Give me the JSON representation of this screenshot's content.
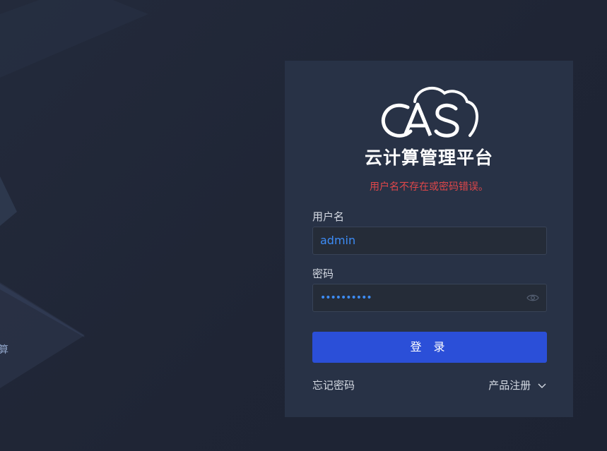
{
  "logo": {
    "text": "CAS"
  },
  "title": "云计算管理平台",
  "error_message": "用户名不存在或密码错误。",
  "form": {
    "username_label": "用户名",
    "username_value": "admin",
    "password_label": "密码",
    "password_mask": "••••••••••"
  },
  "login_button": "登 录",
  "forgot_password": "忘记密码",
  "product_register": "产品注册",
  "background_text": "算",
  "colors": {
    "background": "#1f2535",
    "panel": "#283246",
    "input_background": "#252c38",
    "accent": "#2b4fd8",
    "input_text": "#3d8cf5",
    "error": "#e0474a"
  },
  "icons": [
    "cas-cloud-logo",
    "eye-icon",
    "chevron-down-icon"
  ]
}
